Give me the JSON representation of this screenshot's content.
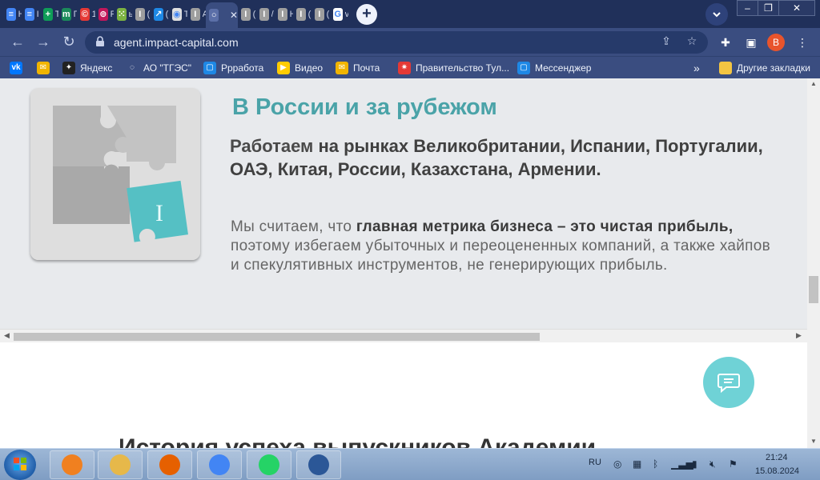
{
  "browser": {
    "tabs": [
      {
        "icon": "docs-icon",
        "color": "#4285f4",
        "glyph": "≡",
        "title": "Н"
      },
      {
        "icon": "docs-icon",
        "color": "#4285f4",
        "glyph": "≡",
        "title": "I"
      },
      {
        "icon": "sheets-icon",
        "color": "#0f9d58",
        "glyph": "+",
        "title": "Т"
      },
      {
        "icon": "m-icon",
        "color": "#1b8a5a",
        "glyph": "m",
        "title": "Г"
      },
      {
        "icon": "copyright-icon",
        "color": "#e53935",
        "glyph": "©",
        "title": "1"
      },
      {
        "icon": "opera-icon",
        "color": "#c2185b",
        "glyph": "⊚",
        "title": "Р"
      },
      {
        "icon": "grid-icon",
        "color": "#7cb342",
        "glyph": "⁙",
        "title": "ь"
      },
      {
        "icon": "impact-icon",
        "color": "#9e9e9e",
        "glyph": "I",
        "title": "("
      },
      {
        "icon": "chart-icon",
        "color": "#1e88e5",
        "glyph": "↗",
        "title": "("
      },
      {
        "icon": "globe-icon",
        "color": "#e0e0e0",
        "glyph": "◉",
        "title": "Т"
      },
      {
        "icon": "impact-icon",
        "color": "#9e9e9e",
        "glyph": "I",
        "title": "А"
      },
      {
        "icon": "loading-icon",
        "color": "#5b6fa8",
        "glyph": "○",
        "title": "",
        "active": true
      },
      {
        "icon": "impact-icon",
        "color": "#9e9e9e",
        "glyph": "I",
        "title": "("
      },
      {
        "icon": "impact-icon",
        "color": "#9e9e9e",
        "glyph": "I",
        "title": "/"
      },
      {
        "icon": "impact-icon",
        "color": "#9e9e9e",
        "glyph": "I",
        "title": "Н"
      },
      {
        "icon": "impact-icon",
        "color": "#9e9e9e",
        "glyph": "I",
        "title": "("
      },
      {
        "icon": "impact-icon",
        "color": "#9e9e9e",
        "glyph": "I",
        "title": "("
      },
      {
        "icon": "google-icon",
        "color": "#ffffff",
        "glyph": "G",
        "title": "v"
      }
    ],
    "url": "agent.impact-capital.com",
    "profile_letter": "В",
    "bookmarks": [
      {
        "icon": "vk-icon",
        "color": "#0077ff",
        "glyph": "vk",
        "label": ""
      },
      {
        "icon": "mail-icon",
        "color": "#f0b400",
        "glyph": "✉",
        "label": ""
      },
      {
        "icon": "yandex-icon",
        "color": "#222222",
        "glyph": "✦",
        "label": "Яндекс"
      },
      {
        "icon": "ao-icon",
        "color": "#3a4d80",
        "glyph": "◌",
        "label": "АО \"ТГЭС\""
      },
      {
        "icon": "chat-icon",
        "color": "#1e88e5",
        "glyph": "▢",
        "label": "Ррработа"
      },
      {
        "icon": "play-icon",
        "color": "#ffcc00",
        "glyph": "▶",
        "label": "Видео"
      },
      {
        "icon": "mail-icon",
        "color": "#f0b400",
        "glyph": "✉",
        "label": "Почта"
      },
      {
        "icon": "gov-icon",
        "color": "#e53935",
        "glyph": "✷",
        "label": "Правительство Тул..."
      },
      {
        "icon": "chat-icon",
        "color": "#1e88e5",
        "glyph": "▢",
        "label": "Мессенджер"
      }
    ],
    "other_bookmarks": "Другие закладки",
    "more_chevron": "»"
  },
  "page": {
    "heading": "В России и за рубежом",
    "lead_prefix": "Работаем ",
    "lead_bold": "на рынках Великобритании, Испании, Португалии, ОАЭ, Китая, России, Казахстана, Армении.",
    "body_prefix": "Мы считаем, что ",
    "body_bold": "главная метрика бизнеса – это чистая прибыль,",
    "body_rest": " поэтому избегаем убыточных и переоцененных компаний, а также хайпов и спекулятивных инструментов, не генерирующих прибыль.",
    "bottom_heading": "История успеха выпускников Академии",
    "puzzle_letter": "I"
  },
  "taskbar": {
    "items": [
      {
        "icon": "media-player-icon",
        "color": "#f08020"
      },
      {
        "icon": "explorer-icon",
        "color": "#e6b84a"
      },
      {
        "icon": "firefox-icon",
        "color": "#e66000"
      },
      {
        "icon": "chrome-icon",
        "color": "#4285f4"
      },
      {
        "icon": "whatsapp-icon",
        "color": "#25d366"
      },
      {
        "icon": "word-icon",
        "color": "#2b5797"
      }
    ],
    "lang": "RU",
    "time": "21:24",
    "date": "15.08.2024"
  }
}
